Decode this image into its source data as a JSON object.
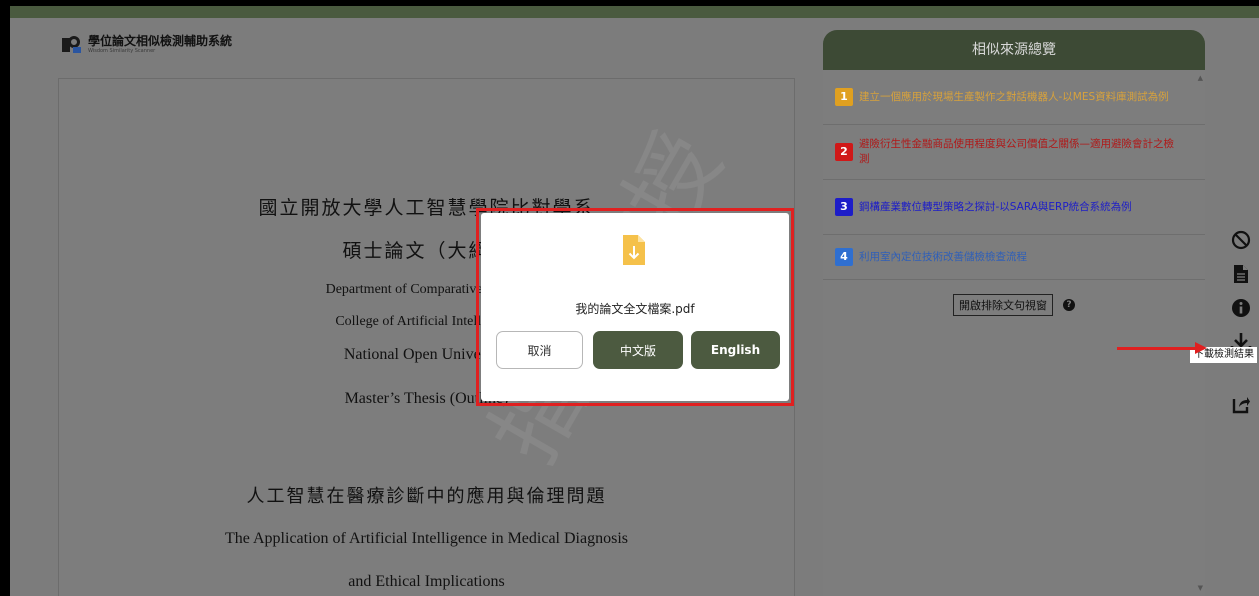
{
  "app": {
    "logo_title": "學位論文相似檢測輔助系統",
    "logo_subtitle": "Wisdom Similarity Scanner"
  },
  "document": {
    "lines": [
      "國立開放大學人工智慧學院比對學系",
      "碩士論文（大綱）",
      "Department of Comparative Studies",
      "College of Artificial Intelligence",
      "National Open University",
      "Master’s Thesis (Outline)",
      "人工智慧在醫療診斷中的應用與倫理問題",
      "The Application of Artificial Intelligence in Medical Diagnosis",
      "and Ethical Implications"
    ],
    "watermark": "指導教授"
  },
  "panel": {
    "title": "相似來源總覽",
    "sources": [
      {
        "num": "1",
        "text": "建立一個應用於現場生產製作之對話機器人-以MES資料庫測試為例",
        "color": "#e0a020",
        "text_color": "#d8a23c"
      },
      {
        "num": "2",
        "text": "避險衍生性金融商品使用程度與公司價值之關係—適用避險會計之檢測",
        "color": "#d01818",
        "text_color": "#b01818"
      },
      {
        "num": "3",
        "text": "鋼構產業數位轉型策略之探討-以SARA與ERP統合系統為例",
        "color": "#1d1dc8",
        "text_color": "#1d1dc8"
      },
      {
        "num": "4",
        "text": "利用室內定位技術改善儲檢檢查流程",
        "color": "#2f6fd0",
        "text_color": "#2f5fb8"
      }
    ],
    "exclude_button": "開啟排除文句視窗",
    "help_label": "?"
  },
  "toolbar": {
    "download_tooltip": "下載檢測結果"
  },
  "modal": {
    "filename": "我的論文全文檔案.pdf",
    "cancel_label": "取消",
    "chinese_label": "中文版",
    "english_label": "English"
  },
  "colors": {
    "brand_dark": "#3d4a35",
    "button_green": "#4c5a40",
    "highlight_red": "#e02020",
    "file_icon": "#f5c14a"
  }
}
